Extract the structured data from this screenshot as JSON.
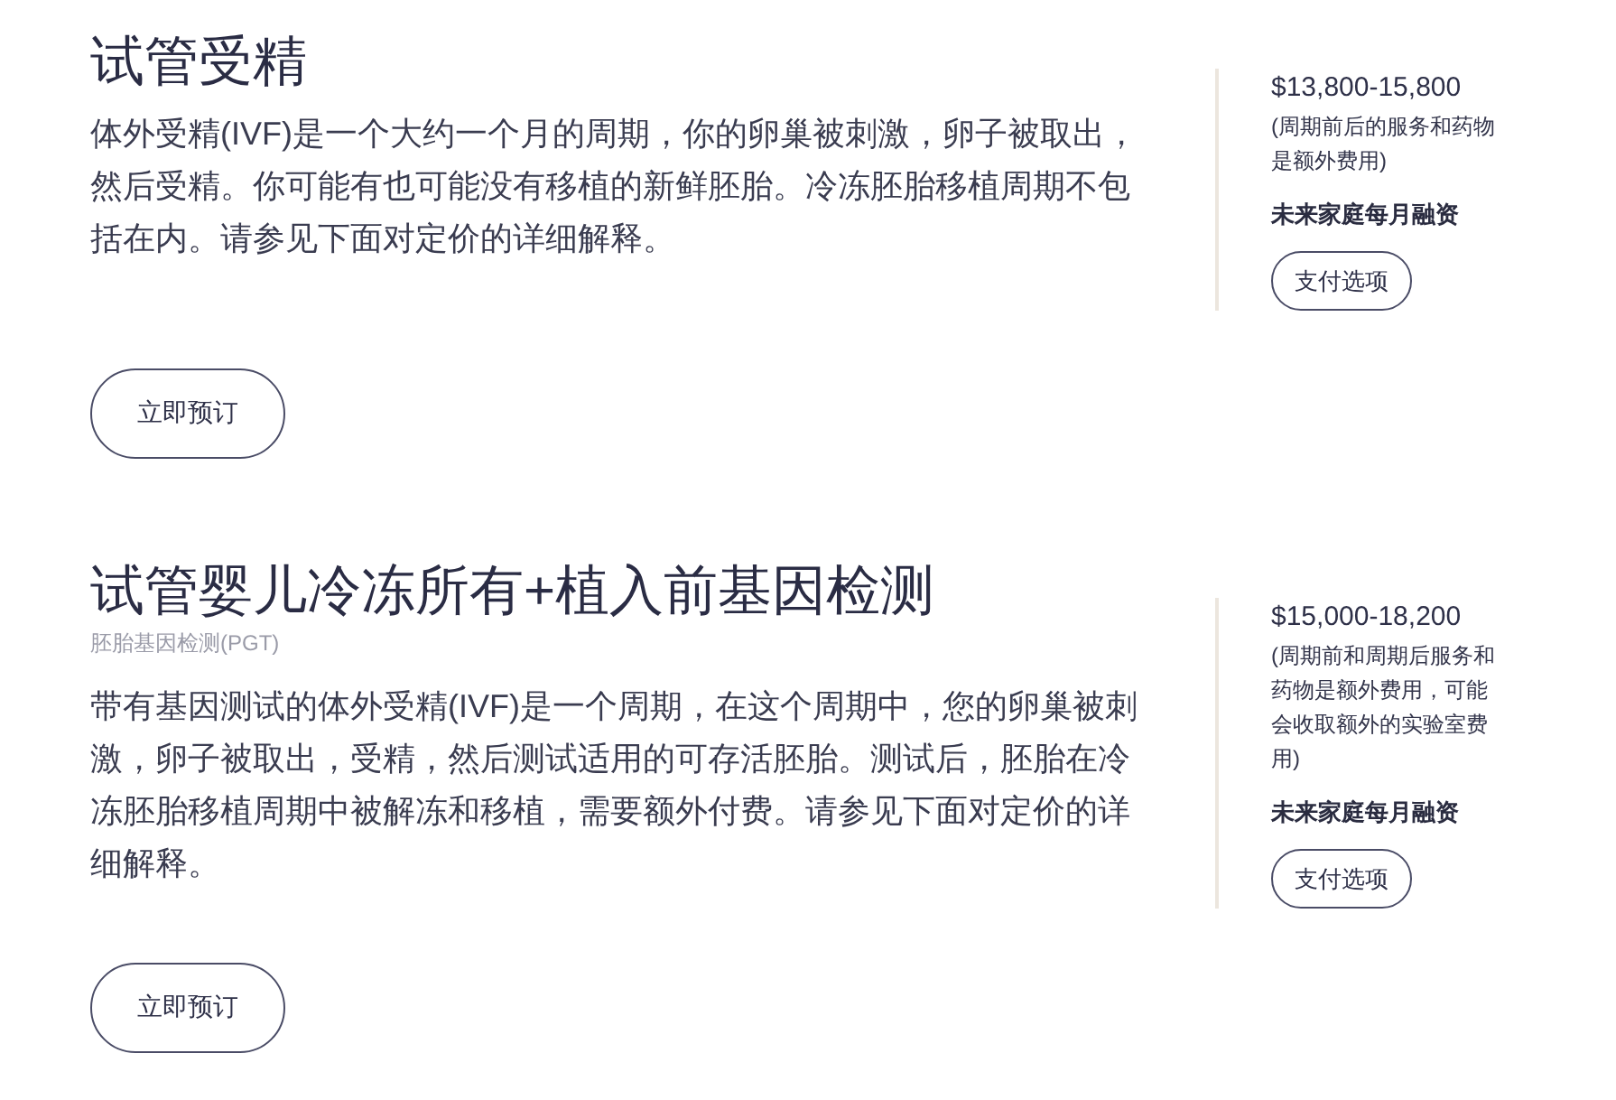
{
  "offers": [
    {
      "title": "试管受精",
      "description": "体外受精(IVF)是一个大约一个月的周期，你的卵巢被刺激，卵子被取出，然后受精。你可能有也可能没有移植的新鲜胚胎。冷冻胚胎移植周期不包括在内。请参见下面对定价的详细解释。",
      "book_button": "立即预订",
      "price": "$13,800-15,800",
      "price_note": "(周期前后的服务和药物是额外费用)",
      "financing_label": "未来家庭每月融资",
      "payment_button": "支付选项"
    },
    {
      "title": "试管婴儿冷冻所有+植入前基因检测",
      "subtitle": "胚胎基因检测(PGT)",
      "description": "带有基因测试的体外受精(IVF)是一个周期，在这个周期中，您的卵巢被刺激，卵子被取出，受精，然后测试适用的可存活胚胎。测试后，胚胎在冷冻胚胎移植周期中被解冻和移植，需要额外付费。请参见下面对定价的详细解释。",
      "book_button": "立即预订",
      "price": "$15,000-18,200",
      "price_note": "(周期前和周期后服务和药物是额外费用，可能会收取额外的实验室费用)",
      "financing_label": "未来家庭每月融资",
      "payment_button": "支付选项"
    }
  ]
}
